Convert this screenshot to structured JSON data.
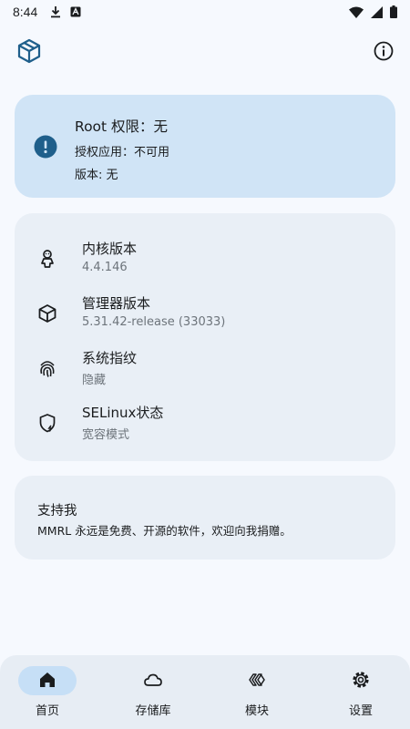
{
  "status_bar": {
    "time": "8:44"
  },
  "root_card": {
    "title": "Root 权限：无",
    "authorized_apps": "授权应用：不可用",
    "version": "版本: 无"
  },
  "info_rows": [
    {
      "title": "内核版本",
      "value": "4.4.146",
      "icon": "android-icon"
    },
    {
      "title": "管理器版本",
      "value": "5.31.42-release (33033)",
      "icon": "cube-icon"
    },
    {
      "title": "系统指纹",
      "value": "隐藏",
      "icon": "fingerprint-icon"
    },
    {
      "title": "SELinux状态",
      "value": "宽容模式",
      "icon": "shield-bolt-icon"
    }
  ],
  "support_card": {
    "title": "支持我",
    "text": "MMRL 永远是免费、开源的软件，欢迎向我捐赠。"
  },
  "bottom_nav": [
    {
      "label": "首页",
      "icon": "home-icon",
      "active": true
    },
    {
      "label": "存储库",
      "icon": "cloud-icon",
      "active": false
    },
    {
      "label": "模块",
      "icon": "modules-icon",
      "active": false
    },
    {
      "label": "设置",
      "icon": "gear-icon",
      "active": false
    }
  ],
  "colors": {
    "background": "#f6f9fe",
    "root_card": "#d0e4f6",
    "accent": "#1f5f8b",
    "card": "#e9eff6",
    "nav_bar": "#e7edf4",
    "nav_active_pill": "#c6dff6"
  }
}
